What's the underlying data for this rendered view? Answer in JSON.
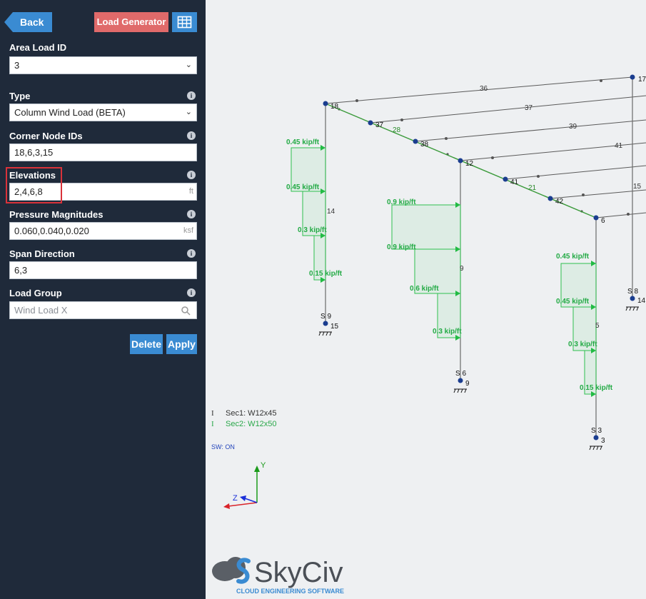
{
  "sidebar": {
    "back_label": "Back",
    "load_generator_label": "Load Generator",
    "table_icon": "table-icon",
    "area_load_id": {
      "label": "Area Load ID",
      "value": "3"
    },
    "type": {
      "label": "Type",
      "value": "Column Wind Load (BETA)"
    },
    "corner_nodes": {
      "label": "Corner Node IDs",
      "value": "18,6,3,15"
    },
    "elevations": {
      "label": "Elevations",
      "value": "2,4,6,8",
      "unit": "ft"
    },
    "pressure": {
      "label": "Pressure Magnitudes",
      "value": "0.060,0.040,0.020",
      "unit": "ksf"
    },
    "span_direction": {
      "label": "Span Direction",
      "value": "6,3"
    },
    "load_group": {
      "label": "Load Group",
      "placeholder": "Wind Load X"
    },
    "delete_label": "Delete",
    "apply_label": "Apply"
  },
  "model": {
    "legend": {
      "sec1": "Sec1: W12x45",
      "sec2": "Sec2: W12x50",
      "sw": "SW: ON"
    },
    "axes": {
      "y": "Y",
      "z": "Z"
    },
    "nodes": [
      "17",
      "18",
      "37",
      "38",
      "12",
      "41",
      "42",
      "6",
      "14",
      "15",
      "9",
      "3"
    ],
    "members": [
      "36",
      "37",
      "39",
      "41",
      "28",
      "21",
      "15",
      "14",
      "9",
      "5"
    ],
    "supports": [
      "S 8",
      "S 9",
      "S 6",
      "S 3"
    ],
    "loads": [
      "0.45 kip/ft",
      "0.3 kip/ft",
      "0.15 kip/ft",
      "0.9 kip/ft",
      "0.6 kip/ft"
    ],
    "colors": {
      "member_green": "#3a9a3a",
      "load_green": "#22bb44",
      "member_gray": "#555555",
      "node": "#1a3d8f"
    }
  },
  "brand": {
    "name": "SkyCiv",
    "tagline": "CLOUD ENGINEERING SOFTWARE"
  }
}
